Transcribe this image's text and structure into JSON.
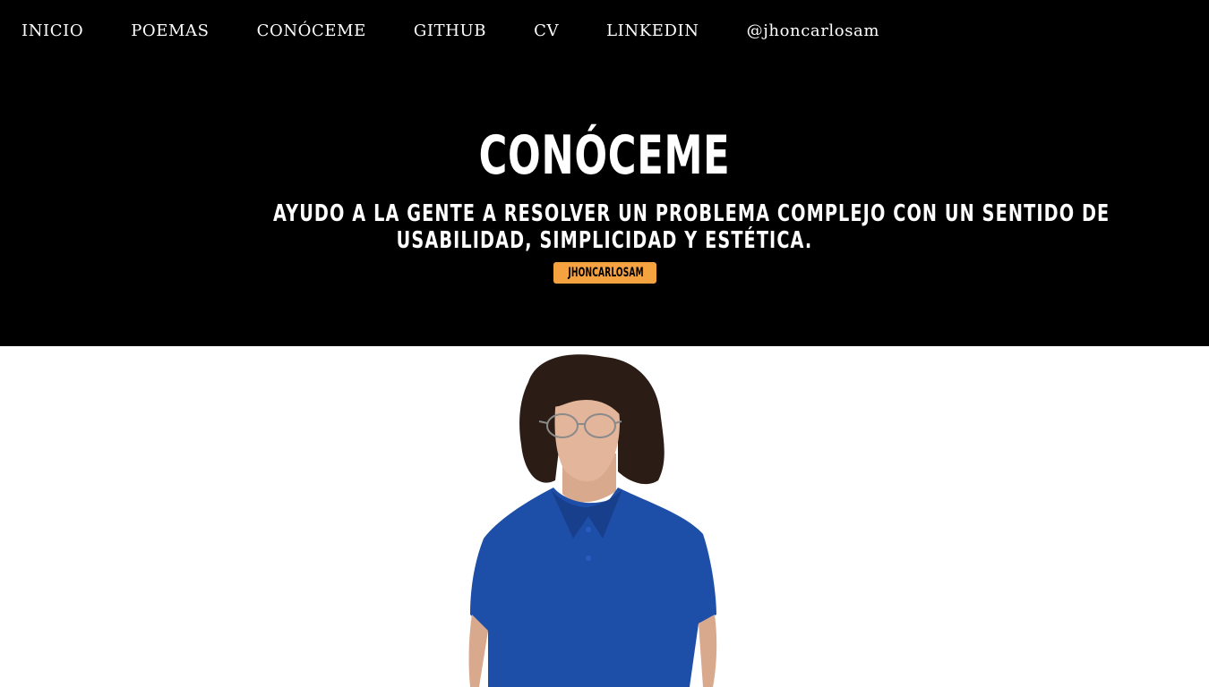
{
  "nav": {
    "items": [
      {
        "label": "INICIO"
      },
      {
        "label": "POEMAS"
      },
      {
        "label": "CONÓCEME"
      },
      {
        "label": "GITHUB"
      },
      {
        "label": "CV"
      },
      {
        "label": "LINKEDIN"
      },
      {
        "label": "@jhoncarlosam"
      }
    ]
  },
  "hero": {
    "title": "CONÓCEME",
    "subtitle_line1": "AYUDO A LA GENTE A RESOLVER UN PROBLEMA COMPLEJO CON UN SENTIDO DE",
    "subtitle_line2": "USABILIDAD, SIMPLICIDAD Y ESTÉTICA.",
    "badge": "JHONCARLOSAM"
  },
  "colors": {
    "hero_background": "#000000",
    "badge_background": "#f5a340",
    "shirt": "#1e4fa8"
  },
  "portrait": {
    "icon": "person-portrait-photo"
  }
}
